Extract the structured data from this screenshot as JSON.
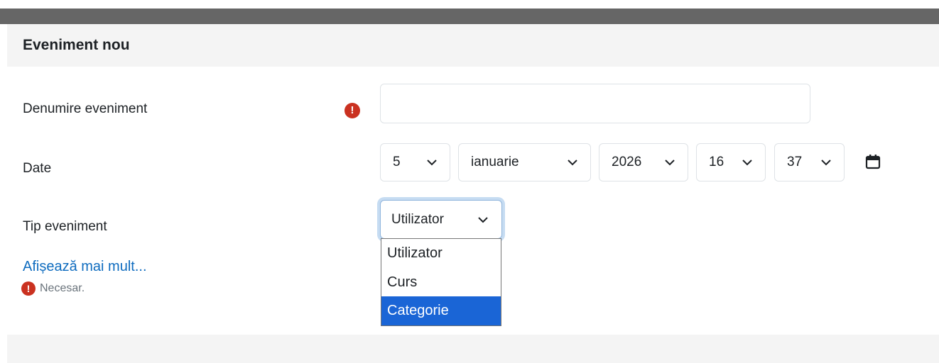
{
  "modal": {
    "title": "Eveniment nou"
  },
  "form": {
    "name_label": "Denumire eveniment",
    "name_value": "",
    "required_icon": "!",
    "date_label": "Date",
    "date": {
      "day": "5",
      "month": "ianuarie",
      "year": "2026",
      "hour": "16",
      "minute": "37"
    },
    "type_label": "Tip eveniment",
    "type_selected": "Utilizator",
    "type_options": [
      "Utilizator",
      "Curs",
      "Categorie"
    ],
    "type_highlighted": "Categorie",
    "show_more": "Afișează mai mult...",
    "required_note": "Necesar."
  },
  "colors": {
    "required": "#ca3120",
    "link": "#0f6cbf",
    "highlight": "#1a65d6"
  },
  "icons": {
    "calendar": "calendar-icon",
    "chevron": "chevron-down-icon",
    "required": "exclamation-circle-icon"
  }
}
